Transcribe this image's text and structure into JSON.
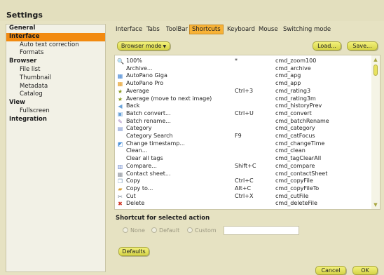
{
  "window": {
    "title": "Settings"
  },
  "sidebar": {
    "items": [
      {
        "label": "General",
        "level": "category",
        "active": false
      },
      {
        "label": "Interface",
        "level": "category",
        "active": true
      },
      {
        "label": "Auto text correction",
        "level": "sub",
        "active": false
      },
      {
        "label": "Formats",
        "level": "sub",
        "active": false
      },
      {
        "label": "Browser",
        "level": "category",
        "active": false
      },
      {
        "label": "File list",
        "level": "sub",
        "active": false
      },
      {
        "label": "Thumbnail",
        "level": "sub",
        "active": false
      },
      {
        "label": "Metadata",
        "level": "sub",
        "active": false
      },
      {
        "label": "Catalog",
        "level": "sub",
        "active": false
      },
      {
        "label": "View",
        "level": "category",
        "active": false
      },
      {
        "label": "Fullscreen",
        "level": "sub",
        "active": false
      },
      {
        "label": "Integration",
        "level": "category",
        "active": false
      }
    ]
  },
  "tabs": [
    {
      "label": "Interface",
      "active": false
    },
    {
      "label": "Tabs",
      "active": false
    },
    {
      "label": "ToolBar",
      "active": false
    },
    {
      "label": "Shortcuts",
      "active": true
    },
    {
      "label": "Keyboard",
      "active": false
    },
    {
      "label": "Mouse",
      "active": false
    },
    {
      "label": "Switching mode",
      "active": false
    }
  ],
  "toolbar": {
    "mode_select": "Browser mode",
    "load_label": "Load...",
    "save_label": "Save..."
  },
  "shortcuts": [
    {
      "icon": "zoom-icon",
      "glyph": "🔍",
      "name": "100%",
      "shortcut": "*",
      "cmd": "cmd_zoom100"
    },
    {
      "icon": "",
      "glyph": "",
      "name": "Archive...",
      "shortcut": "",
      "cmd": "cmd_archive"
    },
    {
      "icon": "autopano-giga-icon",
      "glyph": "▦",
      "name": "AutoPano Giga",
      "shortcut": "",
      "cmd": "cmd_apg"
    },
    {
      "icon": "autopano-pro-icon",
      "glyph": "▦",
      "name": "AutoPano Pro",
      "shortcut": "",
      "cmd": "cmd_app"
    },
    {
      "icon": "star-icon",
      "glyph": "★",
      "name": "Average",
      "shortcut": "Ctrl+3",
      "cmd": "cmd_rating3"
    },
    {
      "icon": "star-icon",
      "glyph": "★",
      "name": "Average (move to next image)",
      "shortcut": "",
      "cmd": "cmd_rating3m"
    },
    {
      "icon": "back-arrow-icon",
      "glyph": "◀",
      "name": "Back",
      "shortcut": "",
      "cmd": "cmd_historyPrev"
    },
    {
      "icon": "batch-convert-icon",
      "glyph": "▣",
      "name": "Batch convert...",
      "shortcut": "Ctrl+U",
      "cmd": "cmd_convert"
    },
    {
      "icon": "batch-rename-icon",
      "glyph": "✎",
      "name": "Batch rename...",
      "shortcut": "",
      "cmd": "cmd_batchRename"
    },
    {
      "icon": "category-icon",
      "glyph": "▤",
      "name": "Category",
      "shortcut": "",
      "cmd": "cmd_category"
    },
    {
      "icon": "",
      "glyph": "",
      "name": "Category Search",
      "shortcut": "F9",
      "cmd": "cmd_catFocus"
    },
    {
      "icon": "timestamp-icon",
      "glyph": "◩",
      "name": "Change timestamp...",
      "shortcut": "",
      "cmd": "cmd_changeTime"
    },
    {
      "icon": "",
      "glyph": "",
      "name": "Clean...",
      "shortcut": "",
      "cmd": "cmd_clean"
    },
    {
      "icon": "",
      "glyph": "",
      "name": "Clear all tags",
      "shortcut": "",
      "cmd": "cmd_tagClearAll"
    },
    {
      "icon": "compare-icon",
      "glyph": "▥",
      "name": "Compare...",
      "shortcut": "Shift+C",
      "cmd": "cmd_compare"
    },
    {
      "icon": "contact-sheet-icon",
      "glyph": "▦",
      "name": "Contact sheet...",
      "shortcut": "",
      "cmd": "cmd_contactSheet"
    },
    {
      "icon": "copy-icon",
      "glyph": "❐",
      "name": "Copy",
      "shortcut": "Ctrl+C",
      "cmd": "cmd_copyFile"
    },
    {
      "icon": "copy-to-folder-icon",
      "glyph": "▰",
      "name": "Copy to...",
      "shortcut": "Alt+C",
      "cmd": "cmd_copyFileTo"
    },
    {
      "icon": "cut-icon",
      "glyph": "✂",
      "name": "Cut",
      "shortcut": "Ctrl+X",
      "cmd": "cmd_cutFile"
    },
    {
      "icon": "delete-icon",
      "glyph": "✖",
      "name": "Delete",
      "shortcut": "",
      "cmd": "cmd_deleteFile"
    }
  ],
  "shortcut_section": {
    "label": "Shortcut for selected action",
    "radio_none": "None",
    "radio_default": "Default",
    "radio_custom": "Custom",
    "custom_value": ""
  },
  "footer": {
    "defaults_label": "Defaults",
    "cancel_label": "Cancel",
    "ok_label": "OK"
  },
  "colors": {
    "accent": "#f28a10",
    "active_tab": "#f7b236",
    "button": "#e3e15c",
    "background": "#e6e2c2"
  }
}
